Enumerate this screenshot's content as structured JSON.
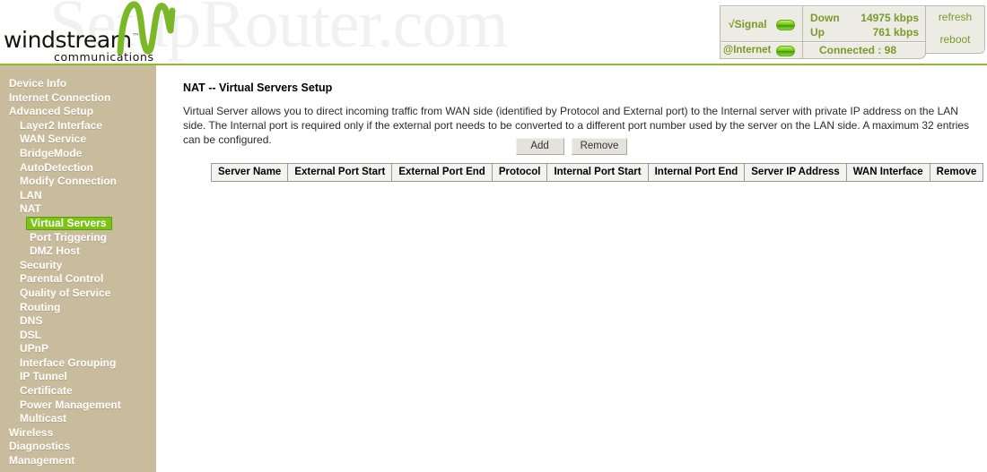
{
  "header": {
    "watermark": "SetupRouter.com",
    "brand_name": "windstream",
    "brand_tm": "™",
    "brand_tagline": "communications",
    "logo_icon": "windstream-swoosh-logo"
  },
  "status": {
    "signal_label": "√Signal",
    "signal_led": "green-led-icon",
    "internet_label": "@Internet",
    "internet_led": "green-led-icon",
    "down_label": "Down",
    "down_value": "14975 kbps",
    "up_label": "Up",
    "up_value": "761 kbps",
    "connection_status": "Connected : 98",
    "refresh_label": "refresh",
    "reboot_label": "reboot"
  },
  "sidebar": {
    "items": [
      {
        "label": "Device Info",
        "level": 0,
        "active": false
      },
      {
        "label": "Internet Connection",
        "level": 0,
        "active": false
      },
      {
        "label": "Advanced Setup",
        "level": 0,
        "active": false
      },
      {
        "label": "Layer2 Interface",
        "level": 1,
        "active": false
      },
      {
        "label": "WAN Service",
        "level": 1,
        "active": false
      },
      {
        "label": "BridgeMode",
        "level": 1,
        "active": false
      },
      {
        "label": "AutoDetection",
        "level": 1,
        "active": false
      },
      {
        "label": "Modify Connection",
        "level": 1,
        "active": false
      },
      {
        "label": "LAN",
        "level": 1,
        "active": false
      },
      {
        "label": "NAT",
        "level": 1,
        "active": false
      },
      {
        "label": "Virtual Servers",
        "level": 2,
        "active": true
      },
      {
        "label": "Port Triggering",
        "level": 2,
        "active": false
      },
      {
        "label": "DMZ Host",
        "level": 2,
        "active": false
      },
      {
        "label": "Security",
        "level": 1,
        "active": false
      },
      {
        "label": "Parental Control",
        "level": 1,
        "active": false
      },
      {
        "label": "Quality of Service",
        "level": 1,
        "active": false
      },
      {
        "label": "Routing",
        "level": 1,
        "active": false
      },
      {
        "label": "DNS",
        "level": 1,
        "active": false
      },
      {
        "label": "DSL",
        "level": 1,
        "active": false
      },
      {
        "label": "UPnP",
        "level": 1,
        "active": false
      },
      {
        "label": "Interface Grouping",
        "level": 1,
        "active": false
      },
      {
        "label": "IP Tunnel",
        "level": 1,
        "active": false
      },
      {
        "label": "Certificate",
        "level": 1,
        "active": false
      },
      {
        "label": "Power Management",
        "level": 1,
        "active": false
      },
      {
        "label": "Multicast",
        "level": 1,
        "active": false
      },
      {
        "label": "Wireless",
        "level": 0,
        "active": false
      },
      {
        "label": "Diagnostics",
        "level": 0,
        "active": false
      },
      {
        "label": "Management",
        "level": 0,
        "active": false
      }
    ]
  },
  "main": {
    "title": "NAT -- Virtual Servers Setup",
    "description": "Virtual Server allows you to direct incoming traffic from WAN side (identified by Protocol and External port) to the Internal server with private IP address on the LAN side. The Internal port is required only if the external port needs to be converted to a different port number used by the server on the LAN side. A maximum 32 entries can be configured.",
    "add_label": "Add",
    "remove_label": "Remove",
    "table": {
      "columns": [
        "Server Name",
        "External Port Start",
        "External Port End",
        "Protocol",
        "Internal Port Start",
        "Internal Port End",
        "Server IP Address",
        "WAN Interface",
        "Remove"
      ],
      "rows": []
    }
  },
  "colors": {
    "brand_green": "#8cbf26",
    "accent_green": "#7ac414",
    "sidebar_bg": "#c8bc9c",
    "status_text": "#7a9a2a"
  }
}
